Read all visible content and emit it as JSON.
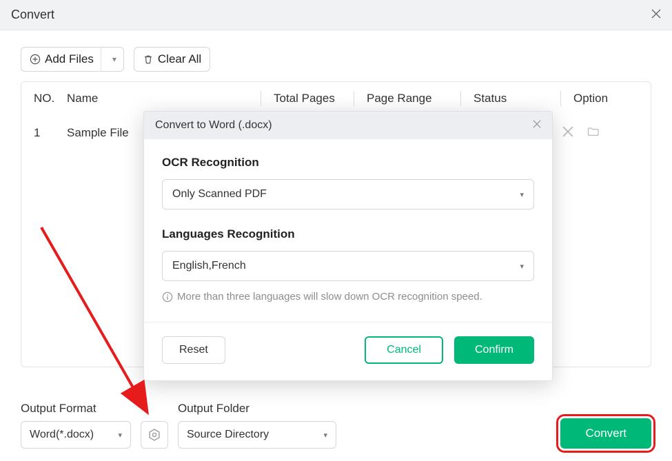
{
  "window": {
    "title": "Convert"
  },
  "toolbar": {
    "add_files": "Add Files",
    "clear_all": "Clear All"
  },
  "table": {
    "headers": {
      "no": "NO.",
      "name": "Name",
      "total_pages": "Total Pages",
      "page_range": "Page Range",
      "status": "Status",
      "option": "Option"
    },
    "rows": [
      {
        "no": "1",
        "name": "Sample File"
      }
    ]
  },
  "modal": {
    "title": "Convert to Word (.docx)",
    "ocr_label": "OCR Recognition",
    "ocr_value": "Only Scanned PDF",
    "lang_label": "Languages Recognition",
    "lang_value": "English,French",
    "note": "More than three languages will slow down OCR recognition speed.",
    "reset": "Reset",
    "cancel": "Cancel",
    "confirm": "Confirm"
  },
  "output": {
    "format_label": "Output Format",
    "format_value": "Word(*.docx)",
    "folder_label": "Output Folder",
    "folder_value": "Source Directory",
    "convert": "Convert"
  }
}
